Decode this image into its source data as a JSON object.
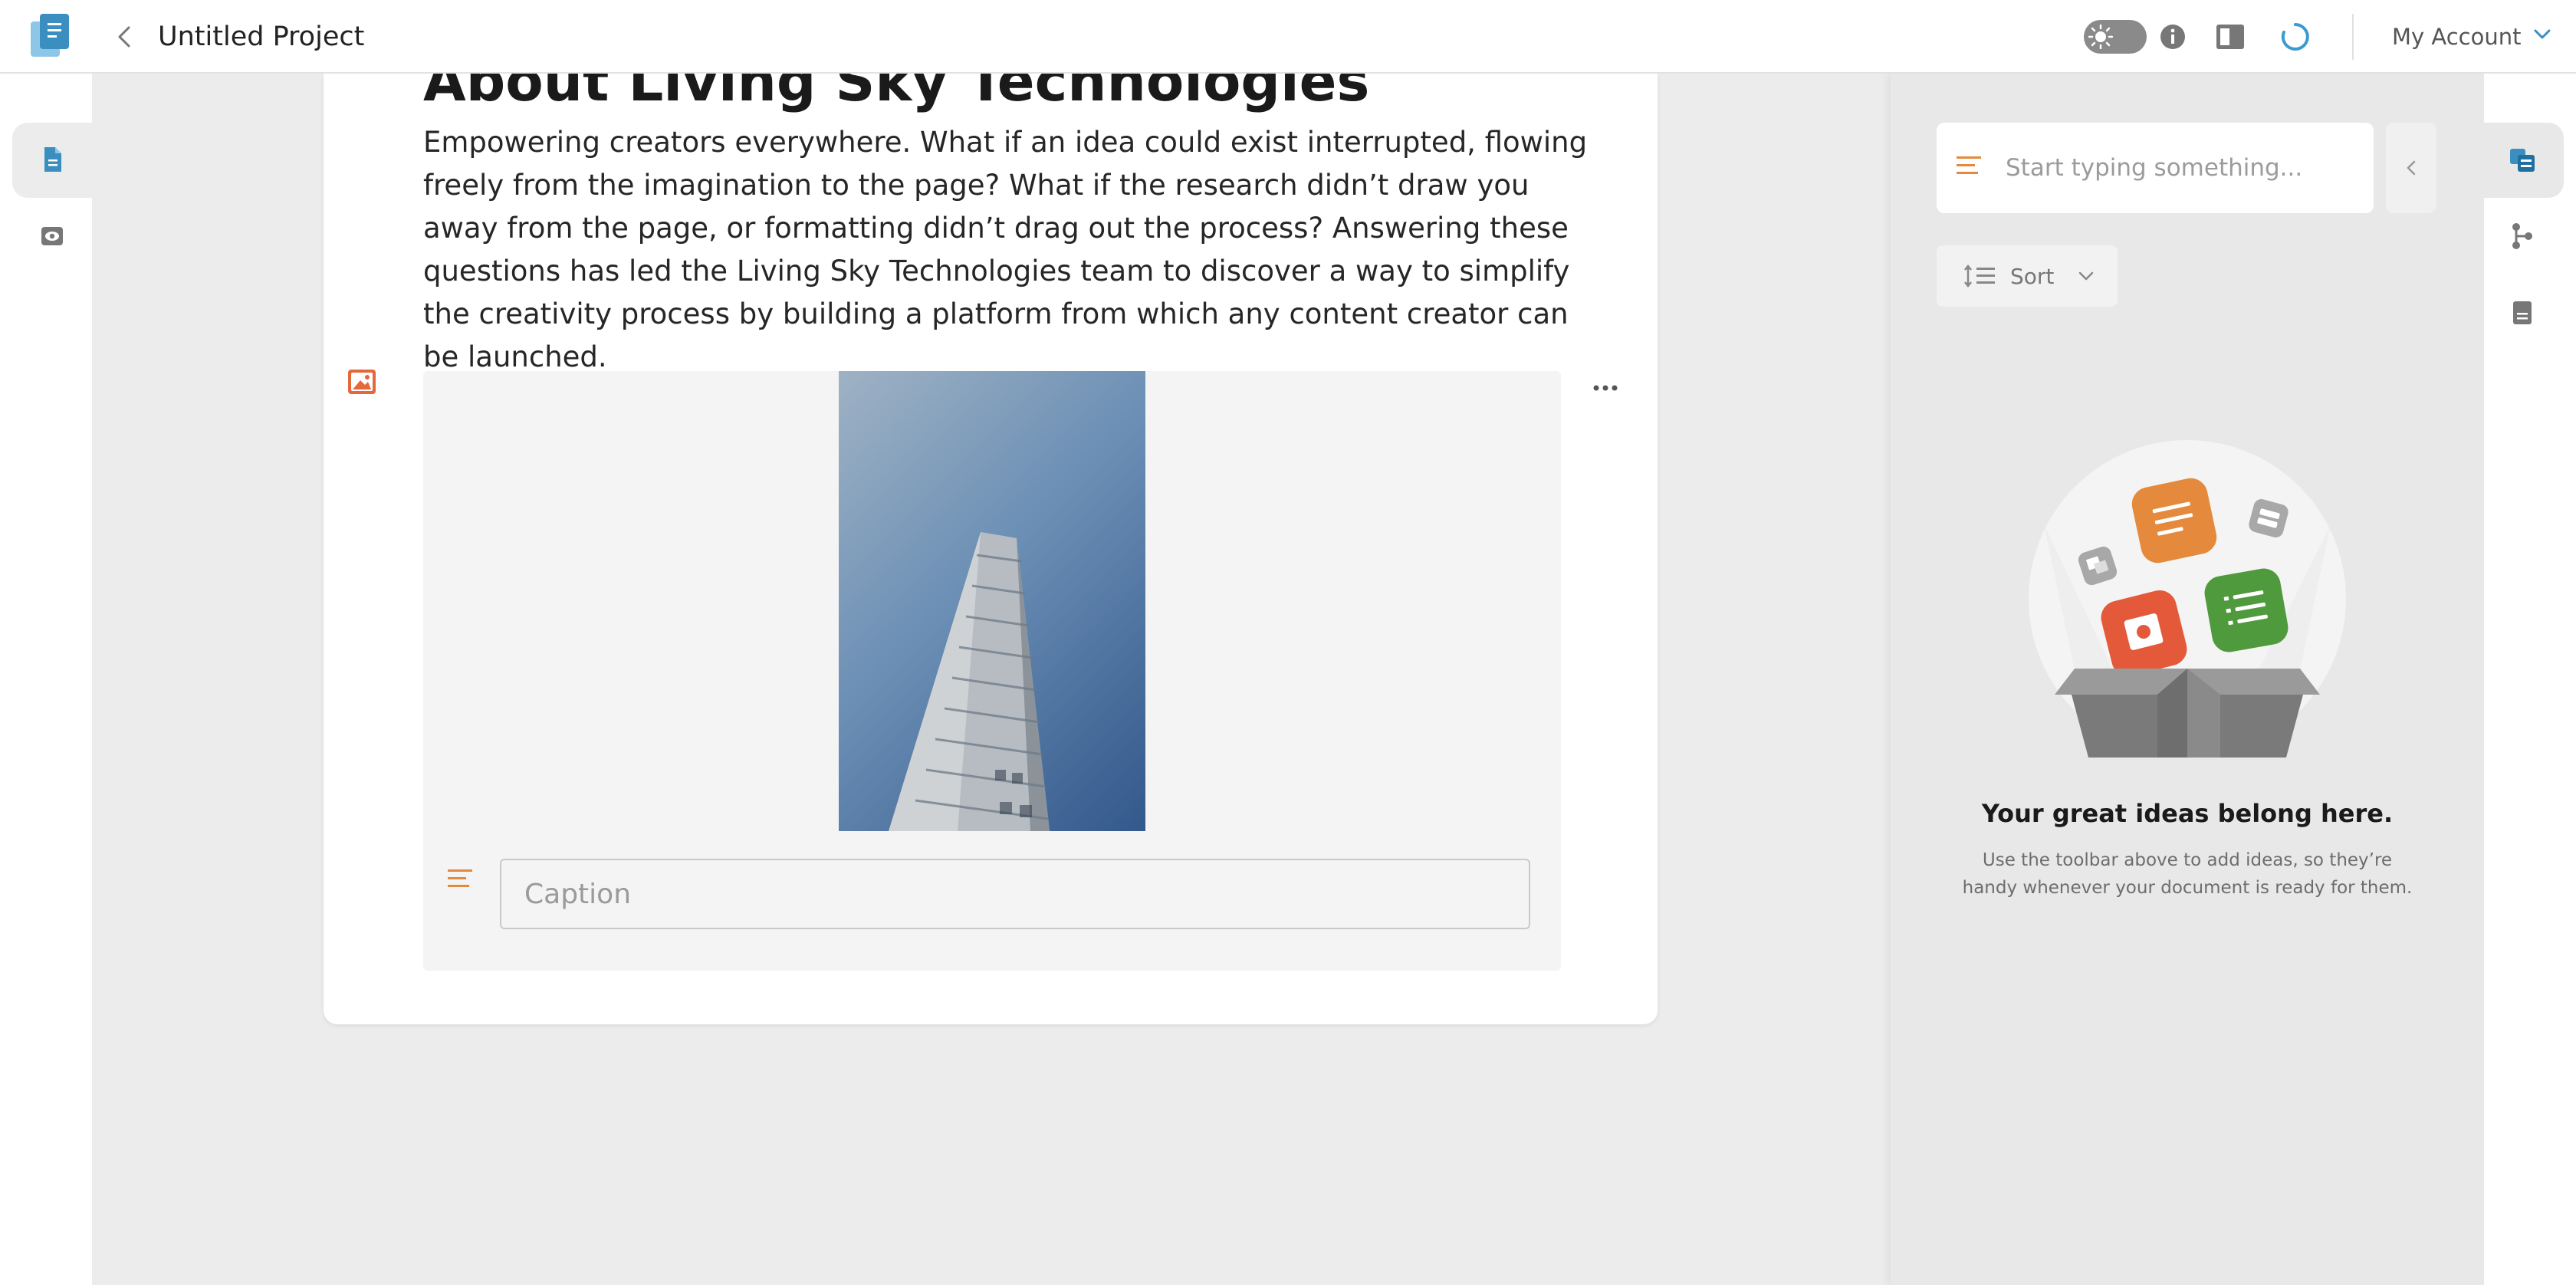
{
  "header": {
    "project_title": "Untitled Project",
    "account_label": "My Account"
  },
  "icons": {
    "logo": "pages-logo-icon",
    "back": "chevron-left-icon",
    "theme": "sun-icon",
    "info": "info-icon",
    "layout": "split-layout-icon",
    "sync": "sync-spinner-icon",
    "account_dropdown": "chevron-down-icon"
  },
  "left_rail": {
    "items": [
      {
        "name": "document",
        "icon": "document-icon",
        "active": true
      },
      {
        "name": "preview",
        "icon": "eye-icon",
        "active": false
      }
    ]
  },
  "document": {
    "heading": "About Living Sky Technologies",
    "paragraph": "Empowering creators everywhere. What if an idea could exist interrupted, flowing freely from the imagination to the page? What if the research didn’t draw you away from the page, or formatting didn’t drag out the process? Answering these questions has led the Living Sky Technologies team to discover a way to simplify the creativity process by building a platform from which any content creator can be launched.",
    "image_block": {
      "image_description": "skyscraper-photo",
      "caption_value": "",
      "caption_placeholder": "Caption"
    }
  },
  "ideas_panel": {
    "input_placeholder": "Start typing something...",
    "sort_label": "Sort",
    "empty_title": "Your great ideas belong here.",
    "empty_description": "Use the toolbar above to add ideas, so they’re handy whenever your document is ready for them."
  },
  "right_rail": {
    "items": [
      {
        "name": "ideas",
        "icon": "ideas-icon",
        "active": true
      },
      {
        "name": "outline",
        "icon": "branch-icon",
        "active": false
      },
      {
        "name": "notes",
        "icon": "note-icon",
        "active": false
      }
    ]
  },
  "colors": {
    "accent_blue": "#3a8fc0",
    "accent_orange": "#e58a3c",
    "image_block_icon": "#e4683a",
    "panel_background": "#e8e8e8"
  }
}
